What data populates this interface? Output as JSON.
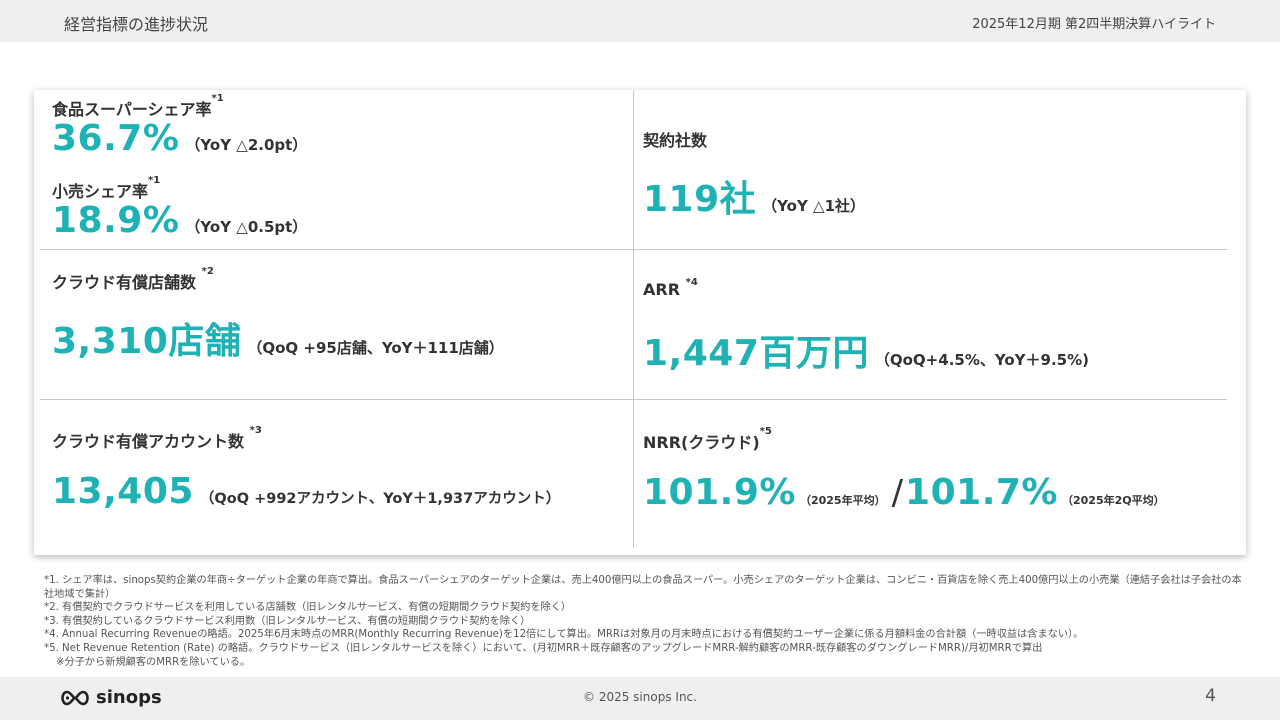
{
  "header": {
    "title": "経営指標の進捗状況",
    "subtitle": "2025年12月期 第2四半期決算ハイライト"
  },
  "metrics": {
    "food_share": {
      "label": "食品スーパーシェア率",
      "sup": "*1",
      "value": "36.7%",
      "note": "（YoY △2.0pt）"
    },
    "retail_share": {
      "label": "小売シェア率",
      "sup": "*1",
      "value": "18.9%",
      "note": "（YoY △0.5pt）"
    },
    "contracts": {
      "label": "契約社数",
      "value": "119社",
      "note": "（YoY △1社）"
    },
    "stores": {
      "label": "クラウド有償店舗数",
      "sup": "*2",
      "value": "3,310店舗",
      "note": "（QoQ +95店舗、YoY＋111店舗）"
    },
    "arr": {
      "label": "ARR",
      "sup": "*4",
      "value": "1,447百万円",
      "note": "（QoQ+4.5%、YoY＋9.5%)"
    },
    "accounts": {
      "label": "クラウド有償アカウント数",
      "sup": "*3",
      "value": "13,405",
      "note": "（QoQ +992アカウント、YoY＋1,937アカウント）"
    },
    "nrr": {
      "label": "NRR(クラウド)",
      "sup": "*5",
      "value1": "101.9%",
      "note1": "（2025年平均）",
      "slash": "/",
      "value2": "101.7%",
      "note2": "（2025年2Q平均）"
    }
  },
  "footnotes": [
    "*1. シェア率は、sinops契約企業の年商÷ターゲット企業の年商で算出。食品スーパーシェアのターゲット企業は、売上400億円以上の食品スーパー。小売シェアのターゲット企業は、コンビニ・百貨店を除く売上400億円以上の小売業（連結子会社は子会社の本社地域で集計）",
    "*2. 有償契約でクラウドサービスを利用している店舗数（旧レンタルサービス、有償の短期間クラウド契約を除く）",
    "*3. 有償契約しているクラウドサービス利用数（旧レンタルサービス、有償の短期間クラウド契約を除く）",
    "*4. Annual Recurring Revenueの略語。2025年6月末時点のMRR(Monthly Recurring Revenue)を12倍にして算出。MRRは対象月の月末時点における有償契約ユーザー企業に係る月額料金の合計額（一時収益は含まない）。",
    "*5. Net Revenue Retention (Rate) の略語。クラウドサービス（旧レンタルサービスを除く）において、(月初MRR＋既存顧客のアップグレードMRR-解約顧客のMRR-既存顧客のダウングレードMRR)/月初MRRで算出",
    "※分子から新規顧客のMRRを除いている。"
  ],
  "footer": {
    "logo_text": "sinops",
    "copyright": "© 2025 sinops Inc.",
    "page_number": "4"
  },
  "colors": {
    "accent": "#1fb2b5",
    "header_bg": "#efefef"
  }
}
